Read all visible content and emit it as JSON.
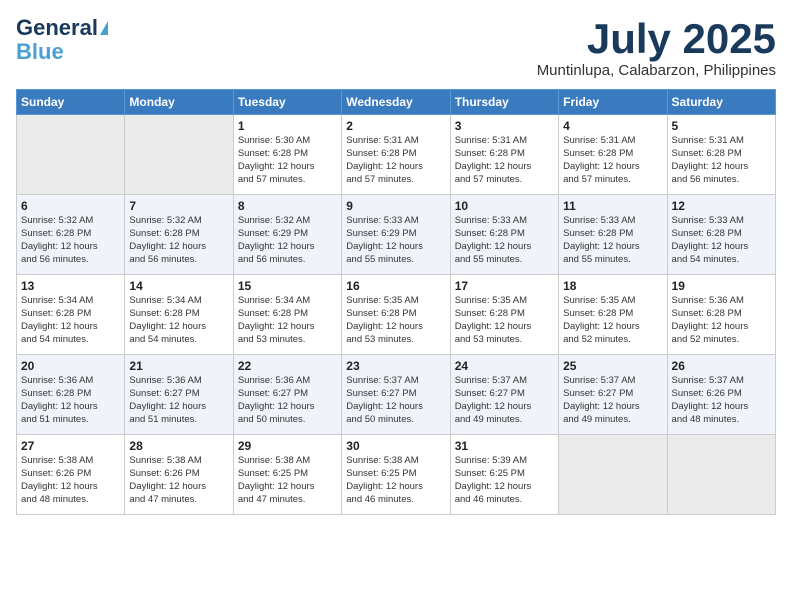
{
  "header": {
    "logo_line1": "General",
    "logo_line2": "Blue",
    "month": "July 2025",
    "location": "Muntinlupa, Calabarzon, Philippines"
  },
  "weekdays": [
    "Sunday",
    "Monday",
    "Tuesday",
    "Wednesday",
    "Thursday",
    "Friday",
    "Saturday"
  ],
  "weeks": [
    [
      {
        "day": "",
        "info": ""
      },
      {
        "day": "",
        "info": ""
      },
      {
        "day": "1",
        "info": "Sunrise: 5:30 AM\nSunset: 6:28 PM\nDaylight: 12 hours\nand 57 minutes."
      },
      {
        "day": "2",
        "info": "Sunrise: 5:31 AM\nSunset: 6:28 PM\nDaylight: 12 hours\nand 57 minutes."
      },
      {
        "day": "3",
        "info": "Sunrise: 5:31 AM\nSunset: 6:28 PM\nDaylight: 12 hours\nand 57 minutes."
      },
      {
        "day": "4",
        "info": "Sunrise: 5:31 AM\nSunset: 6:28 PM\nDaylight: 12 hours\nand 57 minutes."
      },
      {
        "day": "5",
        "info": "Sunrise: 5:31 AM\nSunset: 6:28 PM\nDaylight: 12 hours\nand 56 minutes."
      }
    ],
    [
      {
        "day": "6",
        "info": "Sunrise: 5:32 AM\nSunset: 6:28 PM\nDaylight: 12 hours\nand 56 minutes."
      },
      {
        "day": "7",
        "info": "Sunrise: 5:32 AM\nSunset: 6:28 PM\nDaylight: 12 hours\nand 56 minutes."
      },
      {
        "day": "8",
        "info": "Sunrise: 5:32 AM\nSunset: 6:29 PM\nDaylight: 12 hours\nand 56 minutes."
      },
      {
        "day": "9",
        "info": "Sunrise: 5:33 AM\nSunset: 6:29 PM\nDaylight: 12 hours\nand 55 minutes."
      },
      {
        "day": "10",
        "info": "Sunrise: 5:33 AM\nSunset: 6:28 PM\nDaylight: 12 hours\nand 55 minutes."
      },
      {
        "day": "11",
        "info": "Sunrise: 5:33 AM\nSunset: 6:28 PM\nDaylight: 12 hours\nand 55 minutes."
      },
      {
        "day": "12",
        "info": "Sunrise: 5:33 AM\nSunset: 6:28 PM\nDaylight: 12 hours\nand 54 minutes."
      }
    ],
    [
      {
        "day": "13",
        "info": "Sunrise: 5:34 AM\nSunset: 6:28 PM\nDaylight: 12 hours\nand 54 minutes."
      },
      {
        "day": "14",
        "info": "Sunrise: 5:34 AM\nSunset: 6:28 PM\nDaylight: 12 hours\nand 54 minutes."
      },
      {
        "day": "15",
        "info": "Sunrise: 5:34 AM\nSunset: 6:28 PM\nDaylight: 12 hours\nand 53 minutes."
      },
      {
        "day": "16",
        "info": "Sunrise: 5:35 AM\nSunset: 6:28 PM\nDaylight: 12 hours\nand 53 minutes."
      },
      {
        "day": "17",
        "info": "Sunrise: 5:35 AM\nSunset: 6:28 PM\nDaylight: 12 hours\nand 53 minutes."
      },
      {
        "day": "18",
        "info": "Sunrise: 5:35 AM\nSunset: 6:28 PM\nDaylight: 12 hours\nand 52 minutes."
      },
      {
        "day": "19",
        "info": "Sunrise: 5:36 AM\nSunset: 6:28 PM\nDaylight: 12 hours\nand 52 minutes."
      }
    ],
    [
      {
        "day": "20",
        "info": "Sunrise: 5:36 AM\nSunset: 6:28 PM\nDaylight: 12 hours\nand 51 minutes."
      },
      {
        "day": "21",
        "info": "Sunrise: 5:36 AM\nSunset: 6:27 PM\nDaylight: 12 hours\nand 51 minutes."
      },
      {
        "day": "22",
        "info": "Sunrise: 5:36 AM\nSunset: 6:27 PM\nDaylight: 12 hours\nand 50 minutes."
      },
      {
        "day": "23",
        "info": "Sunrise: 5:37 AM\nSunset: 6:27 PM\nDaylight: 12 hours\nand 50 minutes."
      },
      {
        "day": "24",
        "info": "Sunrise: 5:37 AM\nSunset: 6:27 PM\nDaylight: 12 hours\nand 49 minutes."
      },
      {
        "day": "25",
        "info": "Sunrise: 5:37 AM\nSunset: 6:27 PM\nDaylight: 12 hours\nand 49 minutes."
      },
      {
        "day": "26",
        "info": "Sunrise: 5:37 AM\nSunset: 6:26 PM\nDaylight: 12 hours\nand 48 minutes."
      }
    ],
    [
      {
        "day": "27",
        "info": "Sunrise: 5:38 AM\nSunset: 6:26 PM\nDaylight: 12 hours\nand 48 minutes."
      },
      {
        "day": "28",
        "info": "Sunrise: 5:38 AM\nSunset: 6:26 PM\nDaylight: 12 hours\nand 47 minutes."
      },
      {
        "day": "29",
        "info": "Sunrise: 5:38 AM\nSunset: 6:25 PM\nDaylight: 12 hours\nand 47 minutes."
      },
      {
        "day": "30",
        "info": "Sunrise: 5:38 AM\nSunset: 6:25 PM\nDaylight: 12 hours\nand 46 minutes."
      },
      {
        "day": "31",
        "info": "Sunrise: 5:39 AM\nSunset: 6:25 PM\nDaylight: 12 hours\nand 46 minutes."
      },
      {
        "day": "",
        "info": ""
      },
      {
        "day": "",
        "info": ""
      }
    ]
  ]
}
